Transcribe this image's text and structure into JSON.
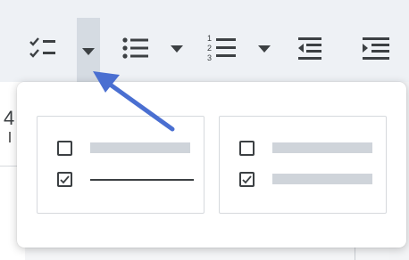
{
  "toolbar": {
    "items": [
      {
        "name": "checklist",
        "icon": "checklist-icon"
      },
      {
        "name": "checklist-dropdown",
        "icon": "caret-down-icon",
        "active": true
      },
      {
        "name": "bulleted-list",
        "icon": "bulleted-list-icon"
      },
      {
        "name": "bulleted-list-dropdown",
        "icon": "caret-down-icon"
      },
      {
        "name": "numbered-list",
        "icon": "numbered-list-icon"
      },
      {
        "name": "numbered-list-dropdown",
        "icon": "caret-down-icon"
      },
      {
        "name": "decrease-indent",
        "icon": "decrease-indent-icon"
      },
      {
        "name": "increase-indent",
        "icon": "increase-indent-icon"
      }
    ]
  },
  "document": {
    "partial_char": "4"
  },
  "checklist_menu": {
    "options": [
      {
        "name": "checklist-style-strikethrough",
        "rows": [
          {
            "checked": false,
            "strikethrough": false
          },
          {
            "checked": true,
            "strikethrough": true
          }
        ]
      },
      {
        "name": "checklist-style-no-strikethrough",
        "rows": [
          {
            "checked": false,
            "strikethrough": false
          },
          {
            "checked": true,
            "strikethrough": false
          }
        ]
      }
    ]
  },
  "annotation": {
    "arrow_color": "#4a6fd1",
    "points_to": "checklist-dropdown"
  },
  "colors": {
    "icon": "#3c4043",
    "placeholder_bar": "#cfd4da",
    "active_button_bg": "#d5dbe2",
    "toolbar_bg": "#eef1f5"
  }
}
